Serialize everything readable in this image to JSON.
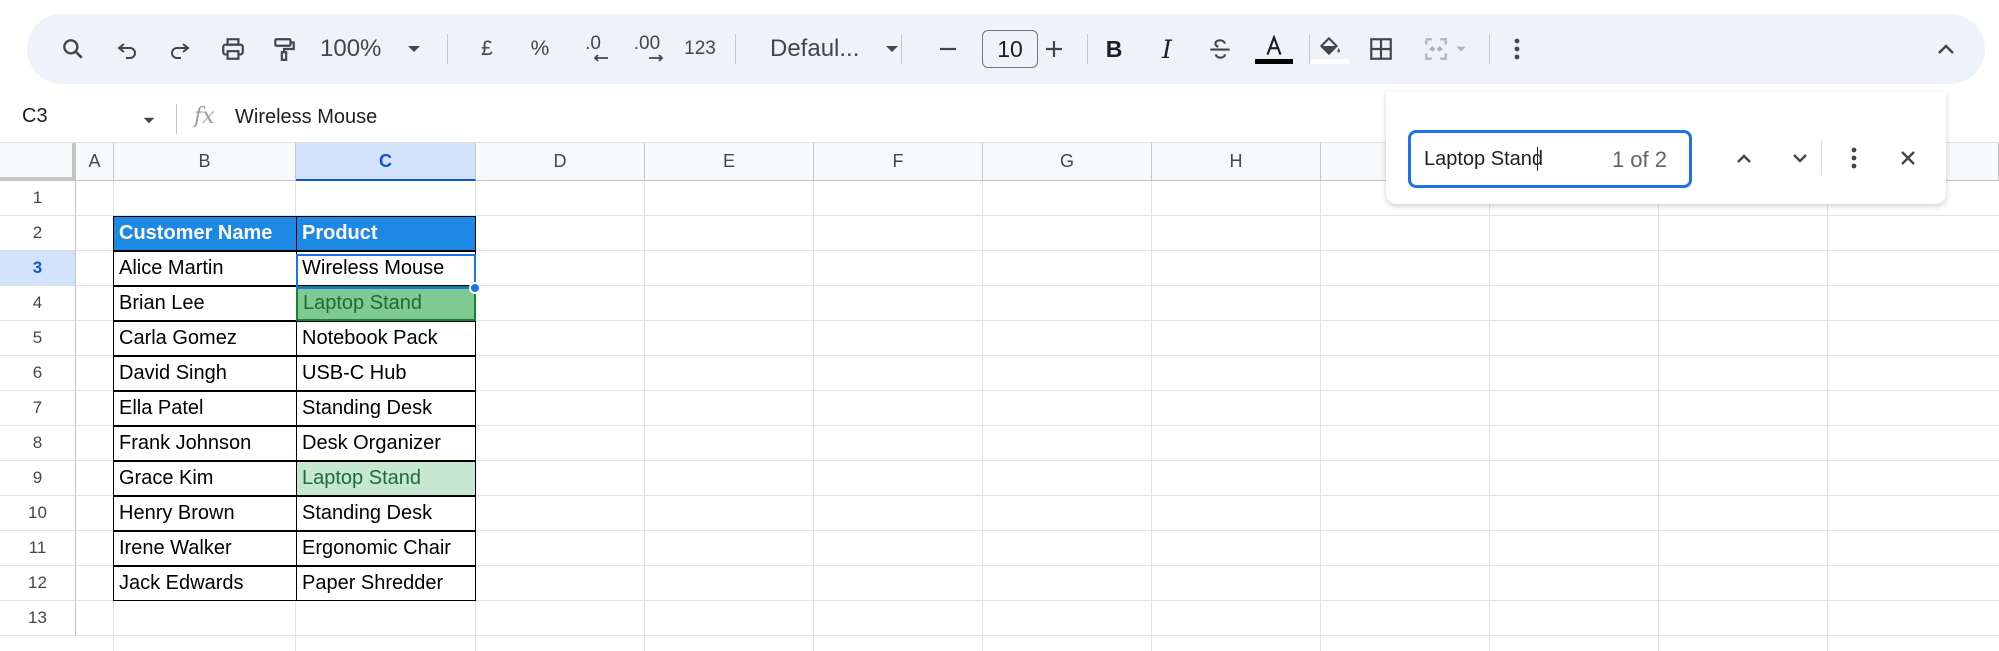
{
  "toolbar": {
    "zoom": "100%",
    "currency": "£",
    "percent": "%",
    "decrease_decimal": ".0",
    "increase_decimal": ".00",
    "number_format": "123",
    "font": "Defaul...",
    "font_size": "10",
    "bold": "B",
    "italic": "I"
  },
  "formula_bar": {
    "name_box": "C3",
    "fx": "fx",
    "value": "Wireless Mouse"
  },
  "columns": [
    "A",
    "B",
    "C",
    "D",
    "E",
    "F",
    "G",
    "H"
  ],
  "rows": [
    "1",
    "2",
    "3",
    "4",
    "5",
    "6",
    "7",
    "8",
    "9",
    "10",
    "11",
    "12",
    "13"
  ],
  "table": {
    "headers": [
      "Customer Name",
      "Product"
    ],
    "rows": [
      [
        "Alice Martin",
        "Wireless Mouse"
      ],
      [
        "Brian Lee",
        "Laptop Stand"
      ],
      [
        "Carla Gomez",
        "Notebook Pack"
      ],
      [
        "David Singh",
        "USB-C Hub"
      ],
      [
        "Ella Patel",
        "Standing Desk"
      ],
      [
        "Frank Johnson",
        "Desk Organizer"
      ],
      [
        "Grace Kim",
        "Laptop Stand"
      ],
      [
        "Henry Brown",
        "Standing Desk"
      ],
      [
        "Irene Walker",
        "Ergonomic Chair"
      ],
      [
        "Jack Edwards",
        "Paper Shredder"
      ]
    ]
  },
  "find": {
    "query": "Laptop Stand",
    "count": "1 of 2"
  },
  "colors": {
    "header_fill": "#1e88e5",
    "match_fill": "#c6e8d0",
    "current_match_fill": "#7fca93",
    "accent": "#1a73e8"
  }
}
